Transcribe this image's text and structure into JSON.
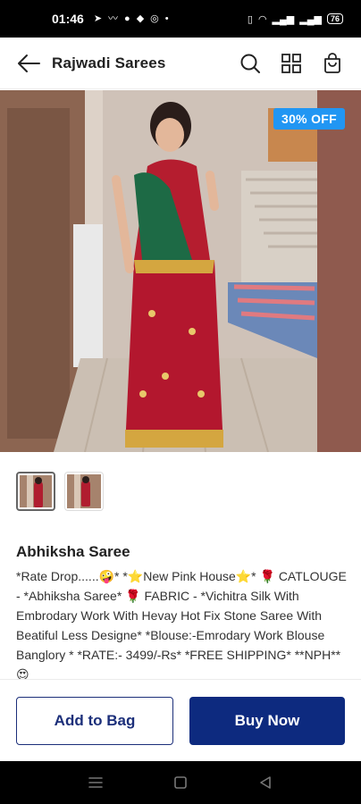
{
  "status_bar": {
    "time": "01:46",
    "battery": "76"
  },
  "app_bar": {
    "title": "Rajwadi Sarees"
  },
  "product": {
    "discount_badge": "30% OFF",
    "thumbnail_count": 2,
    "name": "Abhiksha Saree",
    "description": "*Rate Drop......🤪* *⭐New Pink House⭐* 🌹 CATLOUGE - *Abhiksha Saree* 🌹 FABRIC - *Vichitra Silk With Embrodary Work With Hevay Hot Fix Stone Saree With Beatiful Less Designe* *Blouse:-Emrodary Work Blouse Banglory * *RATE:- 3499/-Rs* *FREE SHIPPING* **NPH** 😍"
  },
  "actions": {
    "add_to_bag": "Add to Bag",
    "buy_now": "Buy Now"
  },
  "colors": {
    "primary": "#0d2a7f",
    "badge": "#2196f3"
  },
  "icons": {
    "back": "arrow-left-icon",
    "search": "search-icon",
    "grid": "grid-icon",
    "bag": "shopping-bag-icon",
    "nav_menu": "menu-icon",
    "nav_home": "square-icon",
    "nav_back": "triangle-back-icon"
  }
}
